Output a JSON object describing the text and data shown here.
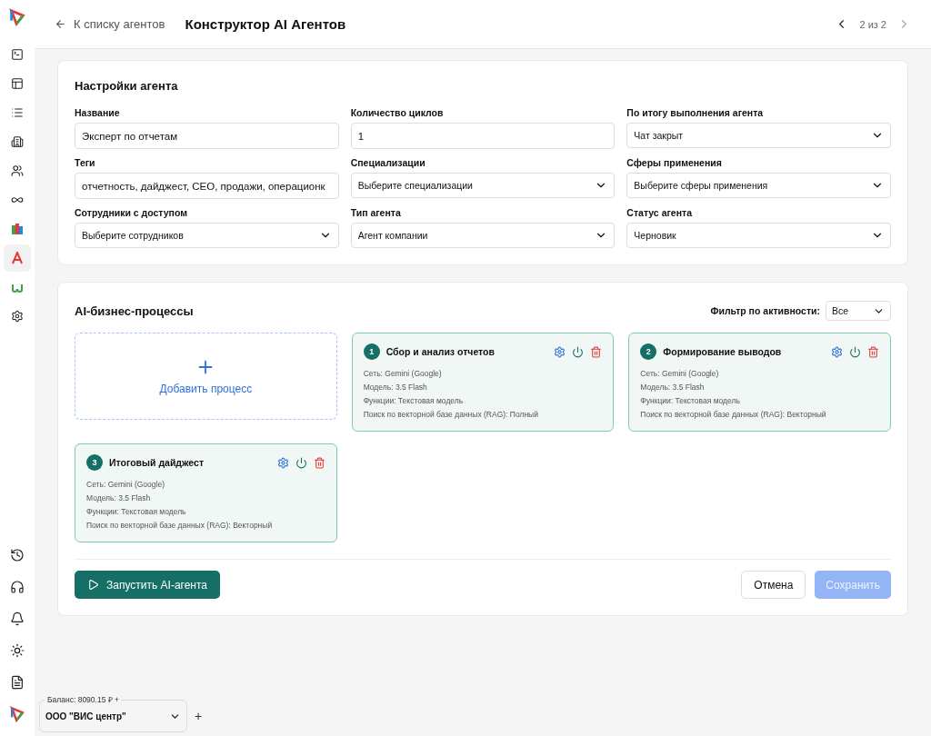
{
  "header": {
    "back_link": "К списку агентов",
    "title": "Конструктор AI Агентов",
    "pager": {
      "text": "2 из 2",
      "prev_disabled": false,
      "next_disabled": true
    }
  },
  "sidebar": {
    "top_items": [
      {
        "selected": false
      },
      {
        "selected": false
      },
      {
        "selected": false
      },
      {
        "selected": false
      },
      {
        "selected": false
      },
      {
        "selected": false
      },
      {
        "selected": false
      },
      {
        "selected": true
      },
      {
        "selected": false
      },
      {
        "selected": false
      }
    ]
  },
  "settings": {
    "title": "Настройки агента",
    "fields": [
      {
        "label": "Название",
        "kind": "input",
        "value": "Эксперт по отчетам"
      },
      {
        "label": "Количество циклов",
        "kind": "input",
        "value": "1"
      },
      {
        "label": "По итогу выполнения агента",
        "kind": "select",
        "value": "Чат закрыт"
      },
      {
        "label": "Теги",
        "kind": "input",
        "value": "отчетность, дайджест, CEO, продажи, операционк"
      },
      {
        "label": "Специализации",
        "kind": "select",
        "value": "Выберите специализации"
      },
      {
        "label": "Сферы применения",
        "kind": "select",
        "value": "Выберите сферы применения"
      },
      {
        "label": "Сотрудники с доступом",
        "kind": "select",
        "value": "Выберите сотрудников"
      },
      {
        "label": "Тип агента",
        "kind": "select",
        "value": "Агент компании"
      },
      {
        "label": "Статус агента",
        "kind": "select",
        "value": "Черновик"
      }
    ]
  },
  "processes": {
    "title": "AI-бизнес-процессы",
    "filter_label": "Фильтр по активности:",
    "filter_value": "Все",
    "add_label": "Добавить процесс",
    "items": [
      {
        "number": "1",
        "title": "Сбор и анализ отчетов",
        "lines": [
          "Сеть: Gemini (Google)",
          "Модель: 3.5 Flash",
          "Функции: Текстовая модель",
          "Поиск по векторной базе данных (RAG): Полный"
        ]
      },
      {
        "number": "2",
        "title": "Формирование выводов",
        "lines": [
          "Сеть: Gemini (Google)",
          "Модель: 3.5 Flash",
          "Функции: Текстовая модель",
          "Поиск по векторной базе данных (RAG): Векторный"
        ]
      },
      {
        "number": "3",
        "title": "Итоговый дайджест",
        "lines": [
          "Сеть: Gemini (Google)",
          "Модель: 3.5 Flash",
          "Функции: Текстовая модель",
          "Поиск по векторной базе данных (RAG): Векторный"
        ]
      }
    ]
  },
  "actions": {
    "run": "Запустить AI-агента",
    "cancel": "Отмена",
    "save": "Сохранить",
    "save_disabled": true
  },
  "account": {
    "balance": "Баланс: 8090.15 ₽ +",
    "company": "ООО \"ВИС центр\"",
    "add": "+"
  }
}
